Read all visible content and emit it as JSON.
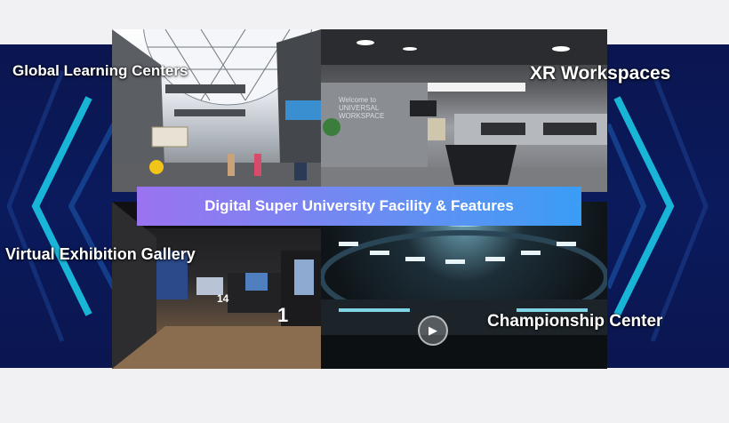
{
  "banner": {
    "title": "Digital Super University Facility & Features"
  },
  "labels": {
    "global": "Global Learning Centers",
    "xr": "XR Workspaces",
    "virtual": "Virtual Exhibition Gallery",
    "champ": "Championship Center"
  },
  "xr_scene": {
    "wall_sign": "Welcome to UNIVERSAL WORKSPACE"
  },
  "gallery_scene": {
    "number_1": "1",
    "number_14": "14"
  },
  "icons": {
    "play": "play-icon",
    "chevrons": "chevron-decoration-icon"
  },
  "colors": {
    "band": "#0b1650",
    "chevron": "#19c7e6",
    "banner_start": "#9a73f0",
    "banner_end": "#3a9df5"
  }
}
